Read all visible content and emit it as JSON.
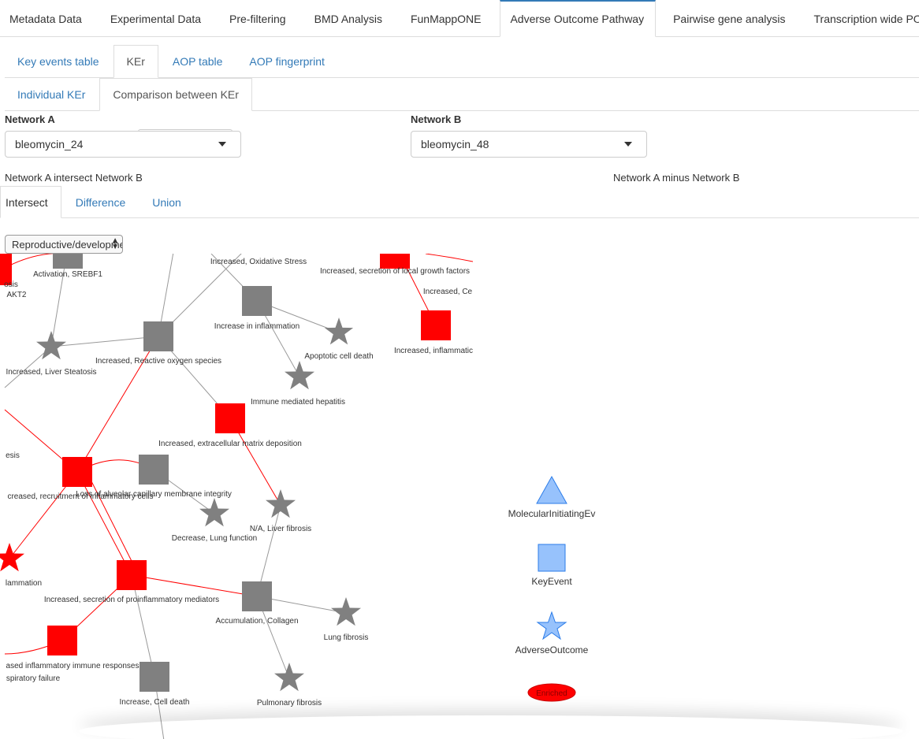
{
  "main_tabs": [
    {
      "label": "Metadata Data",
      "active": false
    },
    {
      "label": "Experimental Data",
      "active": false
    },
    {
      "label": "Pre-filtering",
      "active": false
    },
    {
      "label": "BMD Analysis",
      "active": false
    },
    {
      "label": "FunMappONE",
      "active": false
    },
    {
      "label": "Adverse Outcome Pathway",
      "active": true
    },
    {
      "label": "Pairwise gene analysis",
      "active": false
    },
    {
      "label": "Transcription wide POD",
      "active": false
    }
  ],
  "sub_tabs": [
    {
      "label": "Key events table",
      "active": false
    },
    {
      "label": "KEr",
      "active": true
    },
    {
      "label": "AOP table",
      "active": false
    },
    {
      "label": "AOP fingerprint",
      "active": false
    }
  ],
  "ker_tabs": [
    {
      "label": "Individual KEr",
      "active": false
    },
    {
      "label": "Comparison between KEr",
      "active": true
    }
  ],
  "network_a": {
    "label": "Network A",
    "value": "bleomycin_24"
  },
  "network_b": {
    "label": "Network B",
    "value": "bleomycin_48"
  },
  "intersect_caption": "Network A intersect Network B",
  "minus_caption": "Network A minus Network B",
  "set_tabs": [
    {
      "label": "Intersect",
      "active": true
    },
    {
      "label": "Difference",
      "active": false
    },
    {
      "label": "Union",
      "active": false
    }
  ],
  "category_select": {
    "value": "Reproductive/developmental"
  },
  "colors": {
    "enriched": "#ff0000",
    "normal": "#808080",
    "legend_fill": "#97c2fc",
    "legend_stroke": "#2b7ce9",
    "link": "#337ab7"
  },
  "graph": {
    "nodes": [
      {
        "id": "n1",
        "label": "Activation, SREBF1",
        "shape": "square",
        "enriched": false
      },
      {
        "id": "n2",
        "label": "Increased, Oxidative Stress",
        "shape": "none",
        "enriched": false
      },
      {
        "id": "n3",
        "label": "Increased, secretion of local growth factors",
        "shape": "square",
        "enriched": true
      },
      {
        "id": "n4",
        "label": "Increased, Ce",
        "shape": "none",
        "enriched": false
      },
      {
        "id": "n5",
        "label": "Increase in inflammation",
        "shape": "square",
        "enriched": false
      },
      {
        "id": "n6",
        "label": "Increased, inflammatic",
        "shape": "square",
        "enriched": true
      },
      {
        "id": "n7",
        "label": "Apoptotic cell death",
        "shape": "star",
        "enriched": false
      },
      {
        "id": "n8",
        "label": "Increased, Reactive oxygen species",
        "shape": "square",
        "enriched": false
      },
      {
        "id": "n9",
        "label": "Increased, Liver Steatosis",
        "shape": "star",
        "enriched": false
      },
      {
        "id": "n10",
        "label": "Immune mediated hepatitis",
        "shape": "star",
        "enriched": false
      },
      {
        "id": "n11",
        "label": "Increased, extracellular matrix deposition",
        "shape": "square",
        "enriched": true
      },
      {
        "id": "n12",
        "label": "creased, recruitment of inflammatory cells",
        "shape": "square",
        "enriched": true
      },
      {
        "id": "n13",
        "label": "Loss of alveolar capillary membrane integrity",
        "shape": "square",
        "enriched": false
      },
      {
        "id": "n14",
        "label": "Decrease, Lung function",
        "shape": "star",
        "enriched": false
      },
      {
        "id": "n15",
        "label": "N/A, Liver fibrosis",
        "shape": "star",
        "enriched": false
      },
      {
        "id": "n16",
        "label": "lammation",
        "shape": "star",
        "enriched": true
      },
      {
        "id": "n17",
        "label": "Increased, secretion of proinflammatory mediators",
        "shape": "square",
        "enriched": true
      },
      {
        "id": "n18",
        "label": "Accumulation, Collagen",
        "shape": "square",
        "enriched": false
      },
      {
        "id": "n19",
        "label": "Lung fibrosis",
        "shape": "star",
        "enriched": false
      },
      {
        "id": "n20",
        "label": "ased inflammatory immune responses",
        "shape": "square",
        "enriched": true
      },
      {
        "id": "n21",
        "label": "spiratory failure",
        "shape": "none",
        "enriched": false
      },
      {
        "id": "n22",
        "label": "Increase, Cell death",
        "shape": "square",
        "enriched": false
      },
      {
        "id": "n23",
        "label": "Pulmonary fibrosis",
        "shape": "star",
        "enriched": false
      },
      {
        "id": "n24",
        "label": "osis",
        "shape": "square",
        "enriched": true
      },
      {
        "id": "n25",
        "label": "AKT2",
        "shape": "none",
        "enriched": false
      },
      {
        "id": "n26",
        "label": "esis",
        "shape": "none",
        "enriched": false
      }
    ]
  },
  "legend": [
    {
      "shape": "triangle",
      "label": "MolecularInitiatingEv"
    },
    {
      "shape": "square",
      "label": "KeyEvent"
    },
    {
      "shape": "star",
      "label": "AdverseOutcome"
    },
    {
      "shape": "ellipse",
      "label": "Enriched"
    }
  ]
}
